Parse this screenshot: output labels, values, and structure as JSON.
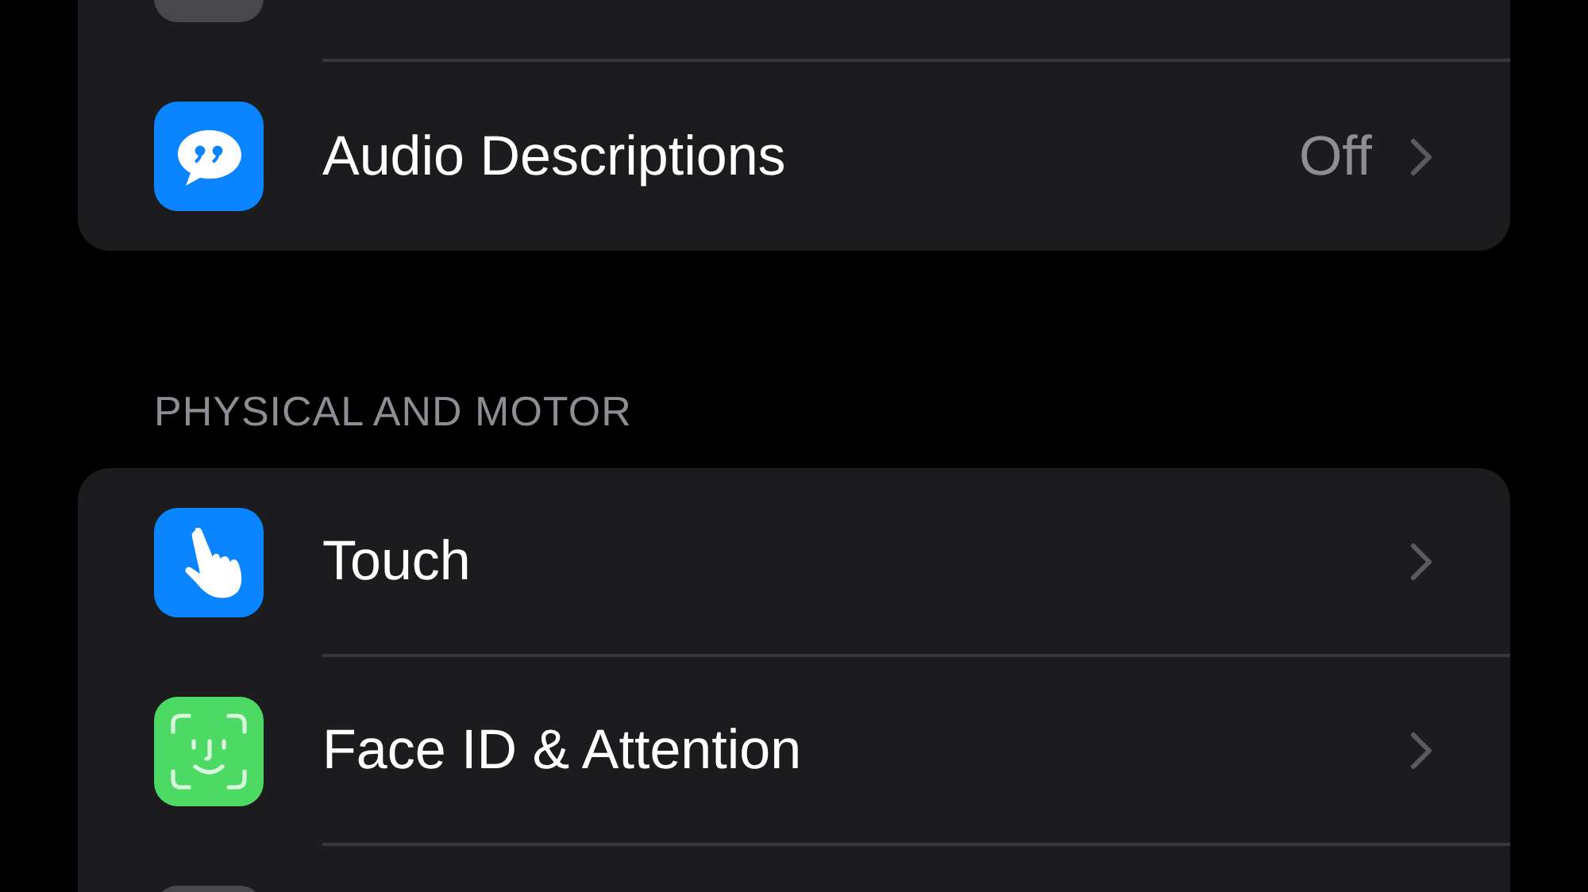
{
  "groups": [
    {
      "rows": [
        {
          "kind": "clipped",
          "color": "#48484a"
        },
        {
          "kind": "link",
          "label": "Audio Descriptions",
          "value": "Off",
          "color": "#0a84ff"
        }
      ]
    },
    {
      "header": "PHYSICAL AND MOTOR",
      "rows": [
        {
          "kind": "link",
          "label": "Touch",
          "color": "#0a84ff"
        },
        {
          "kind": "link",
          "label": "Face ID & Attention",
          "color": "#4cd964"
        },
        {
          "kind": "clipped",
          "color": "#48484a"
        }
      ]
    }
  ]
}
